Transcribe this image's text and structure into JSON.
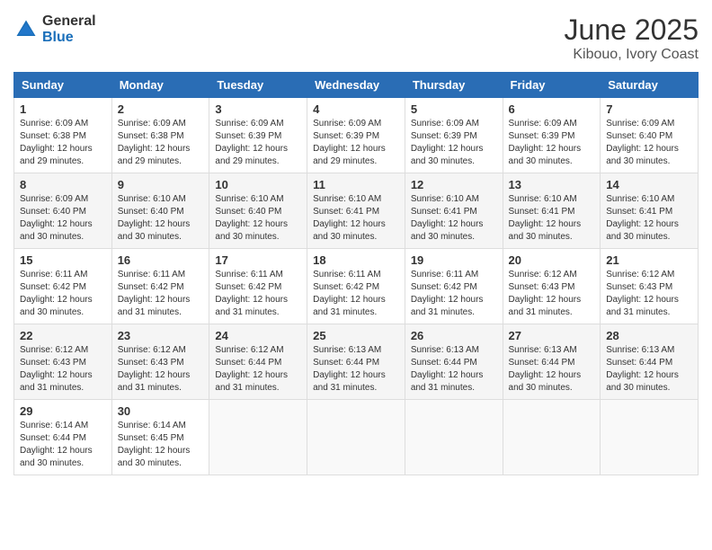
{
  "header": {
    "logo_general": "General",
    "logo_blue": "Blue",
    "month_title": "June 2025",
    "location": "Kibouo, Ivory Coast"
  },
  "weekdays": [
    "Sunday",
    "Monday",
    "Tuesday",
    "Wednesday",
    "Thursday",
    "Friday",
    "Saturday"
  ],
  "weeks": [
    [
      {
        "day": "1",
        "sunrise": "Sunrise: 6:09 AM",
        "sunset": "Sunset: 6:38 PM",
        "daylight": "Daylight: 12 hours and 29 minutes."
      },
      {
        "day": "2",
        "sunrise": "Sunrise: 6:09 AM",
        "sunset": "Sunset: 6:38 PM",
        "daylight": "Daylight: 12 hours and 29 minutes."
      },
      {
        "day": "3",
        "sunrise": "Sunrise: 6:09 AM",
        "sunset": "Sunset: 6:39 PM",
        "daylight": "Daylight: 12 hours and 29 minutes."
      },
      {
        "day": "4",
        "sunrise": "Sunrise: 6:09 AM",
        "sunset": "Sunset: 6:39 PM",
        "daylight": "Daylight: 12 hours and 29 minutes."
      },
      {
        "day": "5",
        "sunrise": "Sunrise: 6:09 AM",
        "sunset": "Sunset: 6:39 PM",
        "daylight": "Daylight: 12 hours and 30 minutes."
      },
      {
        "day": "6",
        "sunrise": "Sunrise: 6:09 AM",
        "sunset": "Sunset: 6:39 PM",
        "daylight": "Daylight: 12 hours and 30 minutes."
      },
      {
        "day": "7",
        "sunrise": "Sunrise: 6:09 AM",
        "sunset": "Sunset: 6:40 PM",
        "daylight": "Daylight: 12 hours and 30 minutes."
      }
    ],
    [
      {
        "day": "8",
        "sunrise": "Sunrise: 6:09 AM",
        "sunset": "Sunset: 6:40 PM",
        "daylight": "Daylight: 12 hours and 30 minutes."
      },
      {
        "day": "9",
        "sunrise": "Sunrise: 6:10 AM",
        "sunset": "Sunset: 6:40 PM",
        "daylight": "Daylight: 12 hours and 30 minutes."
      },
      {
        "day": "10",
        "sunrise": "Sunrise: 6:10 AM",
        "sunset": "Sunset: 6:40 PM",
        "daylight": "Daylight: 12 hours and 30 minutes."
      },
      {
        "day": "11",
        "sunrise": "Sunrise: 6:10 AM",
        "sunset": "Sunset: 6:41 PM",
        "daylight": "Daylight: 12 hours and 30 minutes."
      },
      {
        "day": "12",
        "sunrise": "Sunrise: 6:10 AM",
        "sunset": "Sunset: 6:41 PM",
        "daylight": "Daylight: 12 hours and 30 minutes."
      },
      {
        "day": "13",
        "sunrise": "Sunrise: 6:10 AM",
        "sunset": "Sunset: 6:41 PM",
        "daylight": "Daylight: 12 hours and 30 minutes."
      },
      {
        "day": "14",
        "sunrise": "Sunrise: 6:10 AM",
        "sunset": "Sunset: 6:41 PM",
        "daylight": "Daylight: 12 hours and 30 minutes."
      }
    ],
    [
      {
        "day": "15",
        "sunrise": "Sunrise: 6:11 AM",
        "sunset": "Sunset: 6:42 PM",
        "daylight": "Daylight: 12 hours and 30 minutes."
      },
      {
        "day": "16",
        "sunrise": "Sunrise: 6:11 AM",
        "sunset": "Sunset: 6:42 PM",
        "daylight": "Daylight: 12 hours and 31 minutes."
      },
      {
        "day": "17",
        "sunrise": "Sunrise: 6:11 AM",
        "sunset": "Sunset: 6:42 PM",
        "daylight": "Daylight: 12 hours and 31 minutes."
      },
      {
        "day": "18",
        "sunrise": "Sunrise: 6:11 AM",
        "sunset": "Sunset: 6:42 PM",
        "daylight": "Daylight: 12 hours and 31 minutes."
      },
      {
        "day": "19",
        "sunrise": "Sunrise: 6:11 AM",
        "sunset": "Sunset: 6:42 PM",
        "daylight": "Daylight: 12 hours and 31 minutes."
      },
      {
        "day": "20",
        "sunrise": "Sunrise: 6:12 AM",
        "sunset": "Sunset: 6:43 PM",
        "daylight": "Daylight: 12 hours and 31 minutes."
      },
      {
        "day": "21",
        "sunrise": "Sunrise: 6:12 AM",
        "sunset": "Sunset: 6:43 PM",
        "daylight": "Daylight: 12 hours and 31 minutes."
      }
    ],
    [
      {
        "day": "22",
        "sunrise": "Sunrise: 6:12 AM",
        "sunset": "Sunset: 6:43 PM",
        "daylight": "Daylight: 12 hours and 31 minutes."
      },
      {
        "day": "23",
        "sunrise": "Sunrise: 6:12 AM",
        "sunset": "Sunset: 6:43 PM",
        "daylight": "Daylight: 12 hours and 31 minutes."
      },
      {
        "day": "24",
        "sunrise": "Sunrise: 6:12 AM",
        "sunset": "Sunset: 6:44 PM",
        "daylight": "Daylight: 12 hours and 31 minutes."
      },
      {
        "day": "25",
        "sunrise": "Sunrise: 6:13 AM",
        "sunset": "Sunset: 6:44 PM",
        "daylight": "Daylight: 12 hours and 31 minutes."
      },
      {
        "day": "26",
        "sunrise": "Sunrise: 6:13 AM",
        "sunset": "Sunset: 6:44 PM",
        "daylight": "Daylight: 12 hours and 31 minutes."
      },
      {
        "day": "27",
        "sunrise": "Sunrise: 6:13 AM",
        "sunset": "Sunset: 6:44 PM",
        "daylight": "Daylight: 12 hours and 30 minutes."
      },
      {
        "day": "28",
        "sunrise": "Sunrise: 6:13 AM",
        "sunset": "Sunset: 6:44 PM",
        "daylight": "Daylight: 12 hours and 30 minutes."
      }
    ],
    [
      {
        "day": "29",
        "sunrise": "Sunrise: 6:14 AM",
        "sunset": "Sunset: 6:44 PM",
        "daylight": "Daylight: 12 hours and 30 minutes."
      },
      {
        "day": "30",
        "sunrise": "Sunrise: 6:14 AM",
        "sunset": "Sunset: 6:45 PM",
        "daylight": "Daylight: 12 hours and 30 minutes."
      },
      null,
      null,
      null,
      null,
      null
    ]
  ]
}
